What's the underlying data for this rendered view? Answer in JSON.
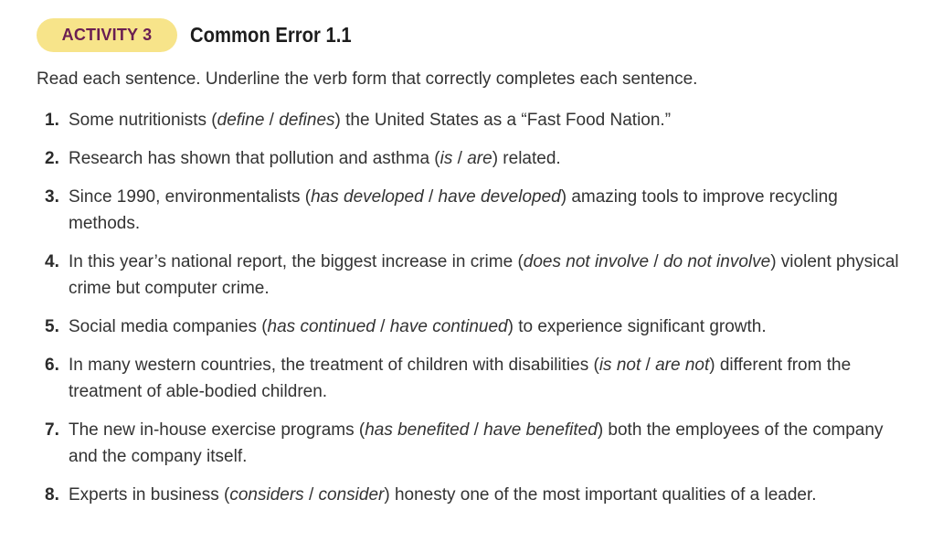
{
  "activity": {
    "badge": "ACTIVITY 3",
    "title": "Common Error 1.1",
    "instructions": "Read each sentence. Underline the verb form that correctly completes each sentence."
  },
  "items": [
    {
      "num": "1.",
      "pre": "Some nutritionists (",
      "opt1": "define",
      "sep": " / ",
      "opt2": "defines",
      "post": ") the United States as a “Fast Food Nation.”"
    },
    {
      "num": "2.",
      "pre": "Research has shown that pollution and asthma (",
      "opt1": "is",
      "sep": " / ",
      "opt2": "are",
      "post": ") related."
    },
    {
      "num": "3.",
      "pre": "Since 1990, environmentalists (",
      "opt1": "has developed",
      "sep": " / ",
      "opt2": "have developed",
      "post": ") amazing tools to improve recycling methods."
    },
    {
      "num": "4.",
      "pre": "In this year’s national report, the biggest increase in crime (",
      "opt1": "does not involve",
      "sep": " / ",
      "opt2": "do not involve",
      "post": ") violent physical crime but computer crime."
    },
    {
      "num": "5.",
      "pre": "Social media companies (",
      "opt1": "has continued",
      "sep": " / ",
      "opt2": "have continued",
      "post": ") to experience significant growth."
    },
    {
      "num": "6.",
      "pre": "In many western countries, the treatment of children with disabilities (",
      "opt1": "is not",
      "sep": " / ",
      "opt2": "are not",
      "post": ") different from the treatment of able-bodied children."
    },
    {
      "num": "7.",
      "pre": "The new in-house exercise programs (",
      "opt1": "has benefited",
      "sep": " / ",
      "opt2": "have benefited",
      "post": ") both the employees of the company and the company itself."
    },
    {
      "num": "8.",
      "pre": "Experts in business (",
      "opt1": "considers",
      "sep": " / ",
      "opt2": "consider",
      "post": ") honesty one of the most important qualities of a leader."
    }
  ]
}
